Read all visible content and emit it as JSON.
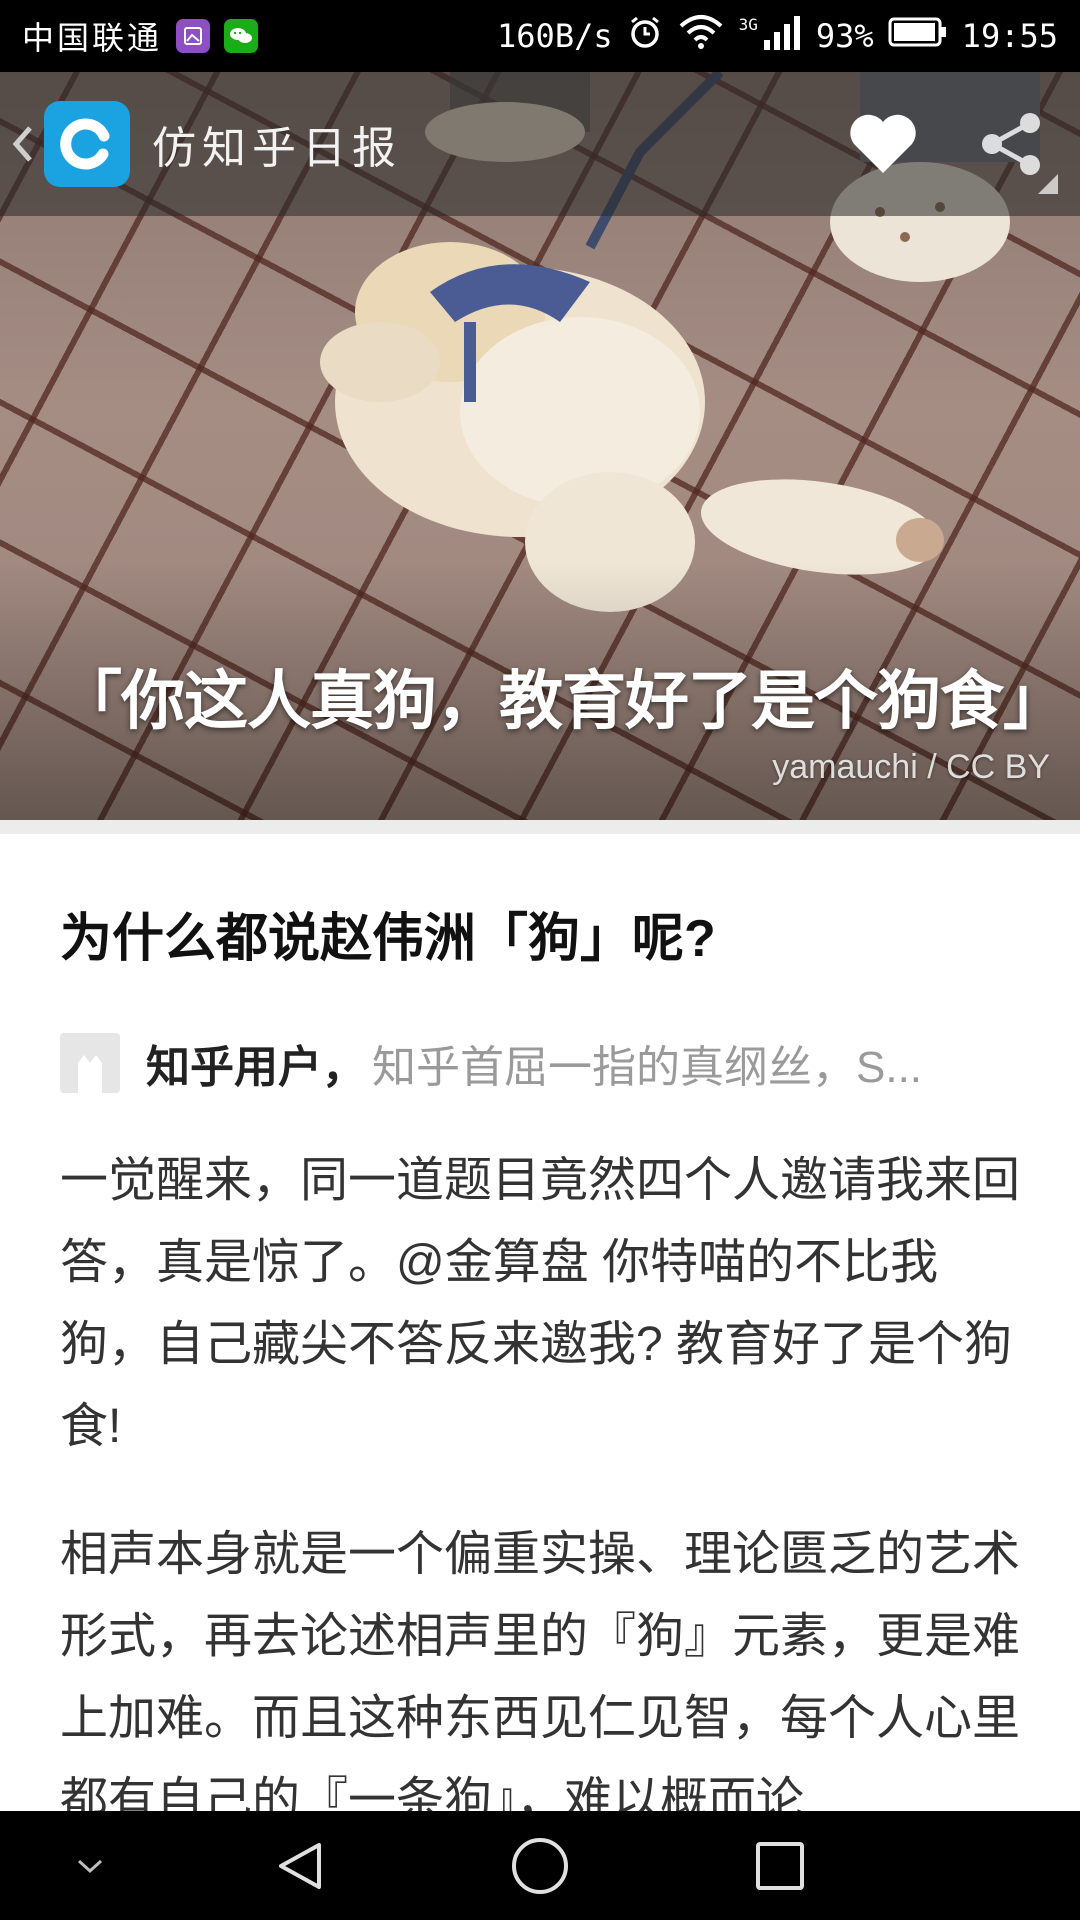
{
  "status_bar": {
    "carrier": "中国联通",
    "net_speed": "160B/s",
    "network_type": "3G",
    "battery": "93%",
    "time": "19:55"
  },
  "toolbar": {
    "app_title": "仿知乎日报",
    "icons": [
      "back-icon",
      "app-logo-icon",
      "heart-icon",
      "share-icon"
    ]
  },
  "hero": {
    "caption": "「你这人真狗，教育好了是个狗食」",
    "credit": "yamauchi / CC BY"
  },
  "article": {
    "question": "为什么都说赵伟洲「狗」呢?",
    "author_name": "知乎用户，",
    "author_bio": "知乎首屈一指的真纲丝，S...",
    "paragraphs": [
      "一觉醒来，同一道题目竟然四个人邀请我来回答，真是惊了。@金算盘 你特喵的不比我狗，自己藏尖不答反来邀我? 教育好了是个狗食!",
      "相声本身就是一个偏重实操、理论匮乏的艺术形式，再去论述相声里的『狗』元素，更是难上加难。而且这种东西见仁见智，每个人心里都有自己的『一条狗』，难以概而论"
    ]
  },
  "colors": {
    "status_bar_bg": "#000000",
    "logo_blue": "#1aa3e0",
    "text_dark": "#111111",
    "text_body": "#333333",
    "text_muted": "#9a9a9a"
  }
}
